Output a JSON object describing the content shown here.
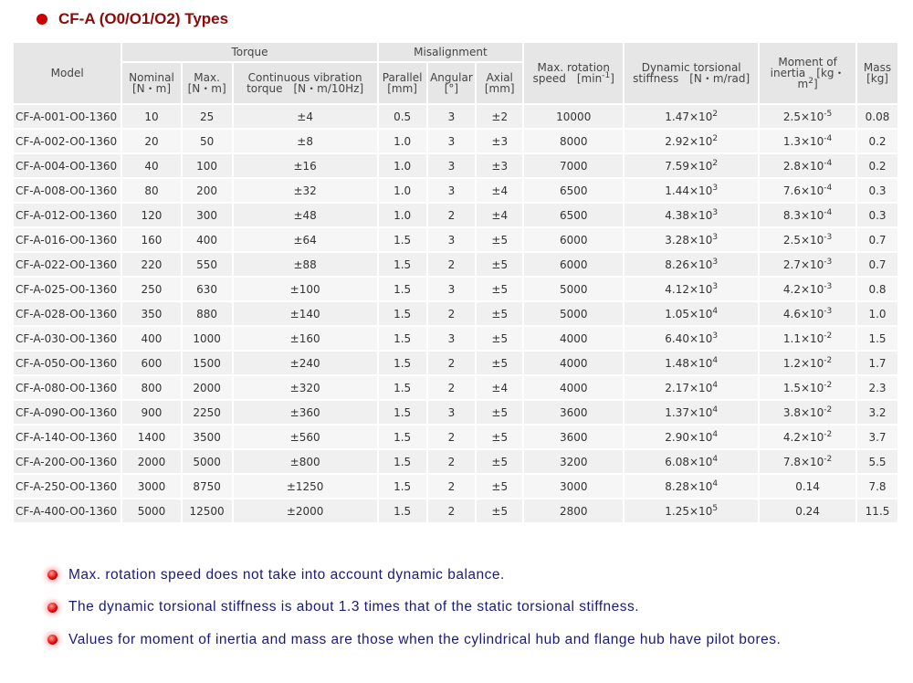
{
  "title": "CF-A (O0/O1/O2) Types",
  "headers": {
    "model": "Model",
    "torque": "Torque",
    "nominal": "Nominal [N・m]",
    "max": "Max. [N・m]",
    "cont": "Continuous vibration torque　[N・m/10Hz]",
    "misalignment": "Misalignment",
    "parallel": "Parallel [mm]",
    "angular": "Angular [°]",
    "axial": "Axial [mm]",
    "speed": "Max. rotation speed　[min",
    "speed_sup": "-1",
    "speed_end": "]",
    "stiffness": "Dynamic torsional stiffness　[N・m/rad]",
    "inertia": "Moment of inertia　[kg・m",
    "inertia_sup": "2",
    "inertia_end": "]",
    "mass": "Mass [kg]"
  },
  "rows": [
    [
      "CF-A-001-O0-1360",
      "10",
      "25",
      "±4",
      "0.5",
      "3",
      "±2",
      "10000",
      [
        "1.47",
        "2"
      ],
      [
        "2.5",
        "-5"
      ],
      "0.08"
    ],
    [
      "CF-A-002-O0-1360",
      "20",
      "50",
      "±8",
      "1.0",
      "3",
      "±3",
      "8000",
      [
        "2.92",
        "2"
      ],
      [
        "1.3",
        "-4"
      ],
      "0.2"
    ],
    [
      "CF-A-004-O0-1360",
      "40",
      "100",
      "±16",
      "1.0",
      "3",
      "±3",
      "7000",
      [
        "7.59",
        "2"
      ],
      [
        "2.8",
        "-4"
      ],
      "0.2"
    ],
    [
      "CF-A-008-O0-1360",
      "80",
      "200",
      "±32",
      "1.0",
      "3",
      "±4",
      "6500",
      [
        "1.44",
        "3"
      ],
      [
        "7.6",
        "-4"
      ],
      "0.3"
    ],
    [
      "CF-A-012-O0-1360",
      "120",
      "300",
      "±48",
      "1.0",
      "2",
      "±4",
      "6500",
      [
        "4.38",
        "3"
      ],
      [
        "8.3",
        "-4"
      ],
      "0.3"
    ],
    [
      "CF-A-016-O0-1360",
      "160",
      "400",
      "±64",
      "1.5",
      "3",
      "±5",
      "6000",
      [
        "3.28",
        "3"
      ],
      [
        "2.5",
        "-3"
      ],
      "0.7"
    ],
    [
      "CF-A-022-O0-1360",
      "220",
      "550",
      "±88",
      "1.5",
      "2",
      "±5",
      "6000",
      [
        "8.26",
        "3"
      ],
      [
        "2.7",
        "-3"
      ],
      "0.7"
    ],
    [
      "CF-A-025-O0-1360",
      "250",
      "630",
      "±100",
      "1.5",
      "3",
      "±5",
      "5000",
      [
        "4.12",
        "3"
      ],
      [
        "4.2",
        "-3"
      ],
      "0.8"
    ],
    [
      "CF-A-028-O0-1360",
      "350",
      "880",
      "±140",
      "1.5",
      "2",
      "±5",
      "5000",
      [
        "1.05",
        "4"
      ],
      [
        "4.6",
        "-3"
      ],
      "1.0"
    ],
    [
      "CF-A-030-O0-1360",
      "400",
      "1000",
      "±160",
      "1.5",
      "3",
      "±5",
      "4000",
      [
        "6.40",
        "3"
      ],
      [
        "1.1",
        "-2"
      ],
      "1.5"
    ],
    [
      "CF-A-050-O0-1360",
      "600",
      "1500",
      "±240",
      "1.5",
      "2",
      "±5",
      "4000",
      [
        "1.48",
        "4"
      ],
      [
        "1.2",
        "-2"
      ],
      "1.7"
    ],
    [
      "CF-A-080-O0-1360",
      "800",
      "2000",
      "±320",
      "1.5",
      "2",
      "±4",
      "4000",
      [
        "2.17",
        "4"
      ],
      [
        "1.5",
        "-2"
      ],
      "2.3"
    ],
    [
      "CF-A-090-O0-1360",
      "900",
      "2250",
      "±360",
      "1.5",
      "3",
      "±5",
      "3600",
      [
        "1.37",
        "4"
      ],
      [
        "3.8",
        "-2"
      ],
      "3.2"
    ],
    [
      "CF-A-140-O0-1360",
      "1400",
      "3500",
      "±560",
      "1.5",
      "2",
      "±5",
      "3600",
      [
        "2.90",
        "4"
      ],
      [
        "4.2",
        "-2"
      ],
      "3.7"
    ],
    [
      "CF-A-200-O0-1360",
      "2000",
      "5000",
      "±800",
      "1.5",
      "2",
      "±5",
      "3200",
      [
        "6.08",
        "4"
      ],
      [
        "7.8",
        "-2"
      ],
      "5.5"
    ],
    [
      "CF-A-250-O0-1360",
      "3000",
      "8750",
      "±1250",
      "1.5",
      "2",
      "±5",
      "3000",
      [
        "8.28",
        "4"
      ],
      "0.14",
      "7.8"
    ],
    [
      "CF-A-400-O0-1360",
      "5000",
      "12500",
      "±2000",
      "1.5",
      "2",
      "±5",
      "2800",
      [
        "1.25",
        "5"
      ],
      "0.24",
      "11.5"
    ]
  ],
  "notes": [
    "Max. rotation speed does not take into account dynamic balance.",
    "The dynamic torsional stiffness is about 1.3 times that of the static torsional stiffness.",
    "Values for moment of inertia and mass are those when the cylindrical hub and flange hub have pilot bores."
  ]
}
